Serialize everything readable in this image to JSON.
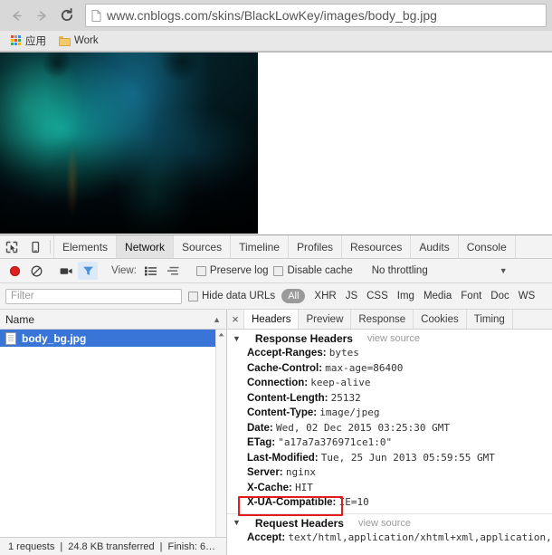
{
  "browser": {
    "nav": {
      "back": "back-arrow",
      "forward": "forward-arrow",
      "reload": "reload"
    },
    "omnibox": {
      "host": "www.cnblogs.com",
      "path": "/skins/BlackLowKey/images/body_bg.jpg",
      "full_url": "www.cnblogs.com/skins/BlackLowKey/images/body_bg.jpg"
    },
    "bookmarks": [
      {
        "label": "应用",
        "icon": "apps-grid-icon"
      },
      {
        "label": "Work",
        "icon": "folder-icon"
      }
    ]
  },
  "devtools": {
    "panel_tabs": [
      {
        "label": "Elements",
        "active": false
      },
      {
        "label": "Network",
        "active": true
      },
      {
        "label": "Sources",
        "active": false
      },
      {
        "label": "Timeline",
        "active": false
      },
      {
        "label": "Profiles",
        "active": false
      },
      {
        "label": "Resources",
        "active": false
      },
      {
        "label": "Audits",
        "active": false
      },
      {
        "label": "Console",
        "active": false
      }
    ],
    "toolbar": {
      "record_title": "record-button",
      "clear_title": "clear-button",
      "capture_title": "capture-screenshots-button",
      "filter_title": "filter-button",
      "view_label": "View:",
      "preserve_log_label": "Preserve log",
      "disable_cache_label": "Disable cache",
      "throttle_value": "No throttling"
    },
    "filterbar": {
      "filter_placeholder": "Filter",
      "hide_data_urls_label": "Hide data URLs",
      "types": [
        "All",
        "XHR",
        "JS",
        "CSS",
        "Img",
        "Media",
        "Font",
        "Doc",
        "WS"
      ]
    },
    "network_list": {
      "column_header": "Name",
      "sort_arrow": "▲",
      "rows": [
        {
          "name": "body_bg.jpg",
          "selected": true
        }
      ],
      "status": {
        "requests": "1 requests",
        "transferred": "24.8 KB transferred",
        "finish": "Finish: 6…"
      }
    },
    "detail": {
      "close": "×",
      "tabs": [
        {
          "label": "Headers",
          "active": true
        },
        {
          "label": "Preview",
          "active": false
        },
        {
          "label": "Response",
          "active": false
        },
        {
          "label": "Cookies",
          "active": false
        },
        {
          "label": "Timing",
          "active": false
        }
      ],
      "response_headers": {
        "title": "Response Headers",
        "view_source": "view source",
        "items": [
          {
            "name": "Accept-Ranges:",
            "value": "bytes",
            "highlight": false
          },
          {
            "name": "Cache-Control:",
            "value": "max-age=86400",
            "highlight": false
          },
          {
            "name": "Connection:",
            "value": "keep-alive",
            "highlight": false
          },
          {
            "name": "Content-Length:",
            "value": "25132",
            "highlight": false
          },
          {
            "name": "Content-Type:",
            "value": "image/jpeg",
            "highlight": false
          },
          {
            "name": "Date:",
            "value": "Wed, 02 Dec 2015 03:25:30 GMT",
            "highlight": false
          },
          {
            "name": "ETag:",
            "value": "\"a17a7a376971ce1:0\"",
            "highlight": false
          },
          {
            "name": "Last-Modified:",
            "value": "Tue, 25 Jun 2013 05:59:55 GMT",
            "highlight": false
          },
          {
            "name": "Server:",
            "value": "nginx",
            "highlight": false
          },
          {
            "name": "X-Cache:",
            "value": "HIT",
            "highlight": true
          },
          {
            "name": "X-UA-Compatible:",
            "value": "IE=10",
            "highlight": false
          }
        ]
      },
      "request_headers": {
        "title": "Request Headers",
        "view_source": "view source",
        "items": [
          {
            "name": "Accept:",
            "value": "text/html,application/xhtml+xml,application,",
            "highlight": false
          }
        ]
      }
    }
  },
  "colors": {
    "selection_blue": "#3875d7",
    "record_red": "#e02020",
    "highlight_red": "#e31b1b",
    "filter_active_blue": "#4a90d9"
  }
}
